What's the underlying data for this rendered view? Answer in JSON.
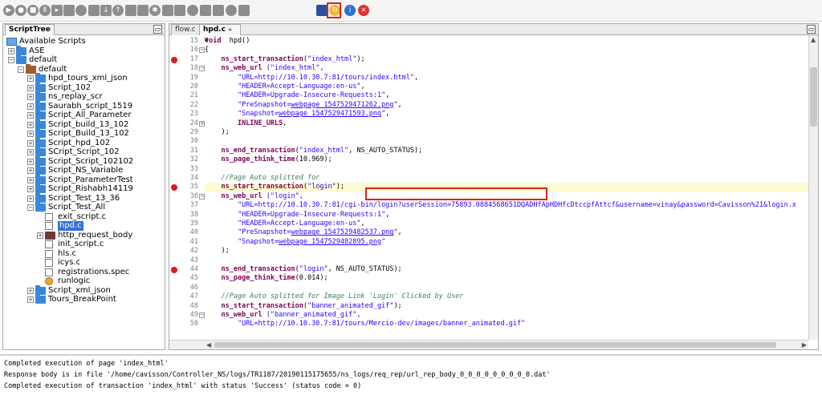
{
  "toolbar": {
    "icons": [
      "play-icon",
      "record-icon",
      "stop-icon",
      "pause-icon",
      "step-icon",
      "comment-icon",
      "chat-icon",
      "copy-icon",
      "download-icon",
      "up-icon",
      "tag-icon",
      "link-icon",
      "settings-icon",
      "image-icon",
      "script-icon",
      "database-icon",
      "screen-icon",
      "circle-icon",
      "cut-icon",
      "tool-icon",
      "save-icon",
      "refresh-icon",
      "info-icon",
      "cancel-icon"
    ],
    "highlighted": "refresh-icon"
  },
  "left": {
    "tab_label": "ScriptTree",
    "tree": [
      {
        "label": "Available Scripts",
        "level": 0
      },
      {
        "label": "ASE",
        "level": 1
      },
      {
        "label": "default",
        "level": 1
      },
      {
        "label": "default",
        "level": 2
      },
      {
        "label": "hpd_tours_xml_json",
        "level": 3
      },
      {
        "label": "Script_102",
        "level": 3
      },
      {
        "label": "ns_replay_scr",
        "level": 3
      },
      {
        "label": "Saurabh_script_1519",
        "level": 3
      },
      {
        "label": "Script_All_Parameter",
        "level": 3
      },
      {
        "label": "Script_build_13_102",
        "level": 3
      },
      {
        "label": "Script_Build_13_102",
        "level": 3
      },
      {
        "label": "Script_hpd_102",
        "level": 3
      },
      {
        "label": "SCript_Script_102",
        "level": 3
      },
      {
        "label": "Script_Script_102102",
        "level": 3
      },
      {
        "label": "Script_NS_Variable",
        "level": 3
      },
      {
        "label": "Script_ParameterTest",
        "level": 3
      },
      {
        "label": "Script_Rishabh14119",
        "level": 3
      },
      {
        "label": "Script_Test_13_36",
        "level": 3
      },
      {
        "label": "Script_Test_All",
        "level": 3
      },
      {
        "label": "exit_script.c",
        "level": 4
      },
      {
        "label": "hpd.c",
        "level": 4
      },
      {
        "label": "http_request_body",
        "level": 4
      },
      {
        "label": "init_script.c",
        "level": 4
      },
      {
        "label": "hls.c",
        "level": 4
      },
      {
        "label": "icys.c",
        "level": 4
      },
      {
        "label": "registrations.spec",
        "level": 4
      },
      {
        "label": "runlogic",
        "level": 4
      },
      {
        "label": "Script_xml_json",
        "level": 3
      },
      {
        "label": "Tours_BreakPoint",
        "level": 3
      }
    ]
  },
  "editor": {
    "tabs": [
      {
        "label": "flow.c"
      },
      {
        "label": "hpd.c"
      }
    ],
    "close_glyph": "×",
    "lines": [
      {
        "n": "15",
        "segs": [
          [
            "k",
            "void"
          ],
          [
            "",
            "  hpd()"
          ]
        ]
      },
      {
        "n": "16",
        "segs": [
          [
            "",
            "{"
          ]
        ]
      },
      {
        "n": "17",
        "segs": [
          [
            "",
            "    "
          ],
          [
            "k",
            "ns_start_transaction"
          ],
          [
            "",
            "("
          ],
          [
            "s",
            "\"index_html\""
          ],
          [
            "",
            ");"
          ]
        ]
      },
      {
        "n": "18",
        "segs": [
          [
            "",
            "    "
          ],
          [
            "k",
            "ns_web_url"
          ],
          [
            "",
            ""
          ],
          [
            "s",
            " (\"index_html\","
          ]
        ]
      },
      {
        "n": "19",
        "segs": [
          [
            "",
            "        "
          ],
          [
            "s",
            "\"URL=http://10.10.30.7:81/tours/index.html\""
          ],
          [
            "",
            ","
          ]
        ]
      },
      {
        "n": "20",
        "segs": [
          [
            "",
            "        "
          ],
          [
            "s",
            "\"HEADER=Accept-Language:en-us\""
          ],
          [
            "",
            ","
          ]
        ]
      },
      {
        "n": "21",
        "segs": [
          [
            "",
            "        "
          ],
          [
            "s",
            "\"HEADER=Upgrade-Insecure-Requests:1\""
          ],
          [
            "",
            ","
          ]
        ]
      },
      {
        "n": "22",
        "segs": [
          [
            "",
            "        "
          ],
          [
            "s",
            "\"PreSnapshot="
          ],
          [
            "u",
            "webpage_1547529471262.png"
          ],
          [
            "s",
            "\""
          ],
          [
            "",
            ","
          ]
        ]
      },
      {
        "n": "23",
        "segs": [
          [
            "",
            "        "
          ],
          [
            "s",
            "\"Snapshot="
          ],
          [
            "u",
            "webpage_1547529471593.png"
          ],
          [
            "s",
            "\""
          ],
          [
            "",
            ","
          ]
        ]
      },
      {
        "n": "24",
        "segs": [
          [
            "",
            "        "
          ],
          [
            "k",
            "INLINE_URLS"
          ],
          [
            "",
            ","
          ]
        ]
      },
      {
        "n": "29",
        "segs": [
          [
            "",
            "    );"
          ]
        ]
      },
      {
        "n": "30",
        "segs": [
          [
            "",
            ""
          ]
        ]
      },
      {
        "n": "31",
        "segs": [
          [
            "",
            "    "
          ],
          [
            "k",
            "ns_end_transaction"
          ],
          [
            "",
            "("
          ],
          [
            "s",
            "\"index_html\""
          ],
          [
            "",
            ", NS_AUTO_STATUS);"
          ]
        ]
      },
      {
        "n": "32",
        "segs": [
          [
            "",
            "    "
          ],
          [
            "k",
            "ns_page_think_time"
          ],
          [
            "",
            "(10.969);"
          ]
        ]
      },
      {
        "n": "33",
        "segs": [
          [
            "",
            ""
          ]
        ]
      },
      {
        "n": "34",
        "segs": [
          [
            "",
            "    "
          ],
          [
            "c",
            "//Page Auto splitted for"
          ]
        ]
      },
      {
        "n": "35",
        "segs": [
          [
            "",
            "    "
          ],
          [
            "k",
            "ns_start_transaction"
          ],
          [
            "",
            "("
          ],
          [
            "s",
            "\"login\""
          ],
          [
            "",
            ");"
          ]
        ]
      },
      {
        "n": "36",
        "segs": [
          [
            "",
            "    "
          ],
          [
            "k",
            "ns_web_url"
          ],
          [
            "",
            ""
          ],
          [
            "s",
            " (\"login\","
          ]
        ]
      },
      {
        "n": "37",
        "segs": [
          [
            "",
            "        "
          ],
          [
            "s",
            "\"URL=http://10.10.30.7:81/cgi-bin/login?userSession=75893.0884568651DQADHfApHDHfcDtccpfAttcf&username=vinay&password=Cavisson%21&login.x"
          ]
        ]
      },
      {
        "n": "38",
        "segs": [
          [
            "",
            "        "
          ],
          [
            "s",
            "\"HEADER=Upgrade-Insecure-Requests:1\""
          ],
          [
            "",
            ","
          ]
        ]
      },
      {
        "n": "39",
        "segs": [
          [
            "",
            "        "
          ],
          [
            "s",
            "\"HEADER=Accept-Language:en-us\""
          ],
          [
            "",
            ","
          ]
        ]
      },
      {
        "n": "40",
        "segs": [
          [
            "",
            "        "
          ],
          [
            "s",
            "\"PreSnapshot="
          ],
          [
            "u",
            "webpage_1547529482537.png"
          ],
          [
            "s",
            "\""
          ],
          [
            "",
            ","
          ]
        ]
      },
      {
        "n": "41",
        "segs": [
          [
            "",
            "        "
          ],
          [
            "s",
            "\"Snapshot="
          ],
          [
            "u",
            "webpage_1547529482895.png"
          ],
          [
            "s",
            "\""
          ]
        ]
      },
      {
        "n": "42",
        "segs": [
          [
            "",
            "    );"
          ]
        ]
      },
      {
        "n": "43",
        "segs": [
          [
            "",
            ""
          ]
        ]
      },
      {
        "n": "44",
        "segs": [
          [
            "",
            "    "
          ],
          [
            "k",
            "ns_end_transaction"
          ],
          [
            "",
            "("
          ],
          [
            "s",
            "\"login\""
          ],
          [
            "",
            ", NS_AUTO_STATUS);"
          ]
        ]
      },
      {
        "n": "45",
        "segs": [
          [
            "",
            "    "
          ],
          [
            "k",
            "ns_page_think_time"
          ],
          [
            "",
            "(0.014);"
          ]
        ]
      },
      {
        "n": "46",
        "segs": [
          [
            "",
            ""
          ]
        ]
      },
      {
        "n": "47",
        "segs": [
          [
            "",
            "    "
          ],
          [
            "c",
            "//Page Auto splitted for Image Link 'Login' Clicked by User"
          ]
        ]
      },
      {
        "n": "48",
        "segs": [
          [
            "",
            "    "
          ],
          [
            "k",
            "ns_start_transaction"
          ],
          [
            "",
            "("
          ],
          [
            "s",
            "\"banner_animated_gif\""
          ],
          [
            "",
            ");"
          ]
        ]
      },
      {
        "n": "49",
        "segs": [
          [
            "",
            "    "
          ],
          [
            "k",
            "ns_web_url"
          ],
          [
            "",
            ""
          ],
          [
            "s",
            " (\"banner_animated_gif\","
          ]
        ]
      },
      {
        "n": "50",
        "segs": [
          [
            "",
            "        "
          ],
          [
            "s",
            "\"URL=http://10.10.30.7:81/tours/Mercio-dev/images/banner_animated.gif\""
          ]
        ]
      }
    ],
    "breakpoint_lines": [
      "17",
      "35",
      "44"
    ],
    "fold_lines": [
      "16",
      "18",
      "24",
      "36",
      "49"
    ],
    "highlighted_line": "35"
  },
  "console": {
    "lines": [
      "Completed execution of page 'index_html'",
      "Response body is in file '/home/cavisson/Controller_NS/logs/TR1187/20190115175655/ns_logs/req_rep/url_rep_body_0_0_0_0_0_0_0_0_0.dat'",
      "Completed execution of transaction 'index_html' with status 'Success' (status code = 0)"
    ]
  }
}
